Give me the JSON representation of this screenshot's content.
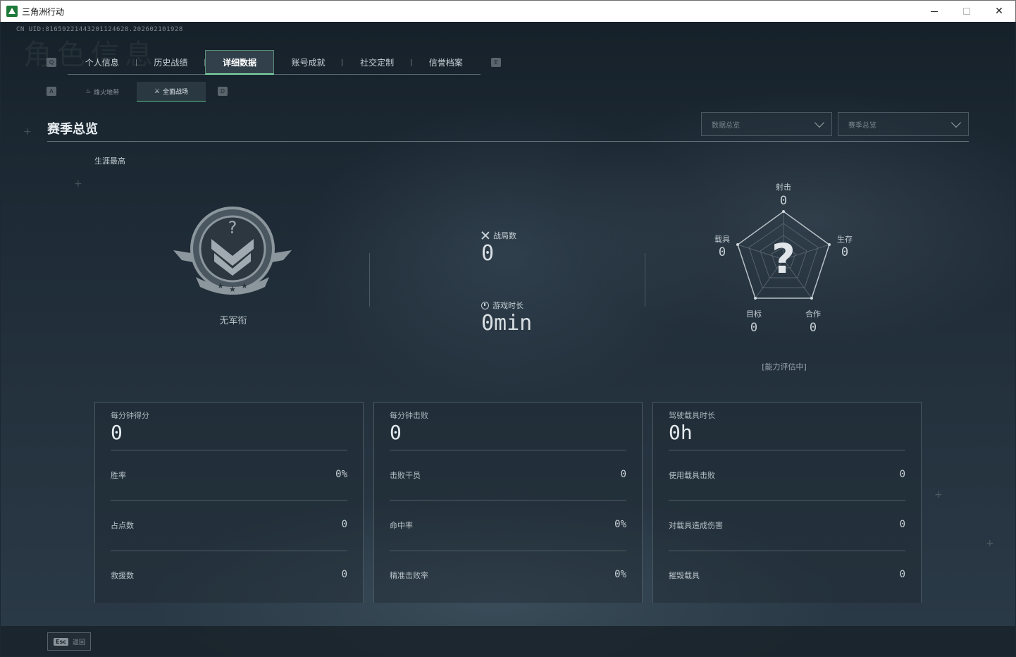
{
  "window": {
    "title": "三角洲行动",
    "uid": "CN UID:8165922144320112462​8.202602101928"
  },
  "ghost_title": "角色信息",
  "keys": {
    "prev_tab": "Q",
    "next_tab": "E",
    "prev_sub": "A",
    "next_sub": "D"
  },
  "tabs": [
    {
      "label": "个人信息"
    },
    {
      "label": "历史战绩"
    },
    {
      "label": "详细数据",
      "active": true
    },
    {
      "label": "账号成就"
    },
    {
      "label": "社交定制"
    },
    {
      "label": "信誉档案"
    }
  ],
  "subtabs": [
    {
      "label": "烽火地带",
      "icon": "flame-icon"
    },
    {
      "label": "全面战场",
      "icon": "battlefield-icon",
      "active": true
    }
  ],
  "section": {
    "title": "赛季总览"
  },
  "dropdowns": [
    {
      "value": "数据总览"
    },
    {
      "value": "赛季总览"
    }
  ],
  "career": {
    "label": "生涯最高",
    "rank_name": "无军衔"
  },
  "stats": {
    "matches_label": "战局数",
    "matches_value": "0",
    "playtime_label": "游戏时长",
    "playtime_value": "0min"
  },
  "radar": {
    "center_mark": "?",
    "axes": [
      {
        "label": "射击",
        "value": "0"
      },
      {
        "label": "生存",
        "value": "0"
      },
      {
        "label": "合作",
        "value": "0"
      },
      {
        "label": "目标",
        "value": "0"
      },
      {
        "label": "载具",
        "value": "0"
      }
    ],
    "status": "[能力评估中]"
  },
  "cards": [
    {
      "head_label": "每分钟得分",
      "head_value": "0",
      "rows": [
        {
          "label": "胜率",
          "value": "0%"
        },
        {
          "label": "占点数",
          "value": "0"
        },
        {
          "label": "救援数",
          "value": "0"
        }
      ]
    },
    {
      "head_label": "每分钟击败",
      "head_value": "0",
      "rows": [
        {
          "label": "击败干员",
          "value": "0"
        },
        {
          "label": "命中率",
          "value": "0%"
        },
        {
          "label": "精准击败率",
          "value": "0%"
        }
      ]
    },
    {
      "head_label": "驾驶载具时长",
      "head_value": "0h",
      "rows": [
        {
          "label": "使用载具击败",
          "value": "0"
        },
        {
          "label": "对载具造成伤害",
          "value": "0"
        },
        {
          "label": "摧毁载具",
          "value": "0"
        }
      ]
    }
  ],
  "footer": {
    "esc_key": "Esc",
    "esc_label": "返回"
  },
  "colors": {
    "accent": "#7fd9a6",
    "background": "#1f2c37"
  }
}
